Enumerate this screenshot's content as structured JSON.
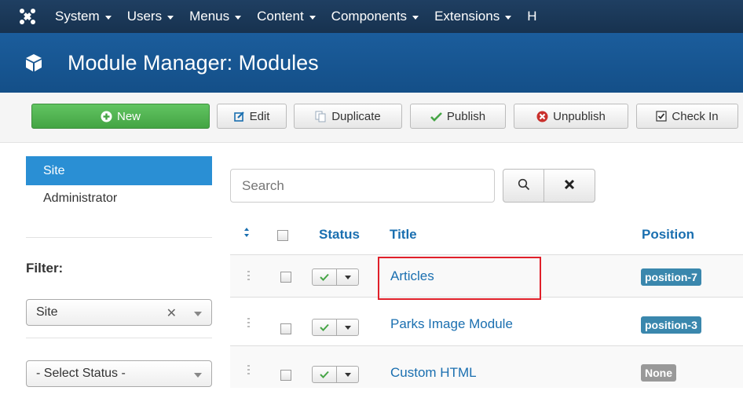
{
  "topnav": {
    "menus": [
      {
        "label": "System"
      },
      {
        "label": "Users"
      },
      {
        "label": "Menus"
      },
      {
        "label": "Content"
      },
      {
        "label": "Components"
      },
      {
        "label": "Extensions"
      },
      {
        "label": "H"
      }
    ]
  },
  "header": {
    "title": "Module Manager: Modules"
  },
  "toolbar": {
    "new_label": "New",
    "edit_label": "Edit",
    "duplicate_label": "Duplicate",
    "publish_label": "Publish",
    "unpublish_label": "Unpublish",
    "checkin_label": "Check In"
  },
  "sidebar": {
    "items": [
      {
        "label": "Site"
      },
      {
        "label": "Administrator"
      }
    ],
    "filter_label": "Filter:",
    "client_select": "Site",
    "status_select": "- Select Status -"
  },
  "search": {
    "placeholder": "Search"
  },
  "table": {
    "headers": {
      "status": "Status",
      "title": "Title",
      "position": "Position"
    },
    "rows": [
      {
        "title": "Articles",
        "position": "position-7",
        "position_style": "info"
      },
      {
        "title": "Parks Image Module",
        "position": "position-3",
        "position_style": "info"
      },
      {
        "title": "Custom HTML",
        "position": "None",
        "position_style": "none"
      }
    ]
  },
  "colors": {
    "topnav": "#1c3a5a",
    "header": "#185896",
    "new_button": "#51b351",
    "active_sidebar": "#2a8fd4",
    "link": "#1a6fb0",
    "badge_info": "#3a87ad",
    "highlight": "#e0202a"
  }
}
